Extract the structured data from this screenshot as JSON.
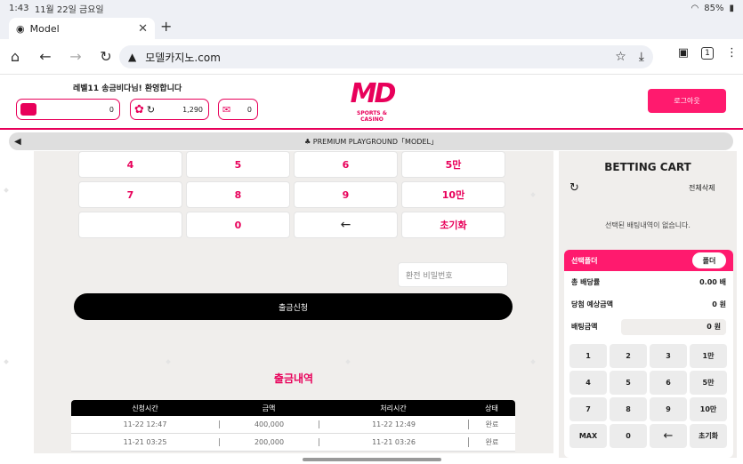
{
  "status_bar": {
    "time": "1:43",
    "date": "11월 22일 금요일",
    "battery": "85%"
  },
  "tab": {
    "title": "Model"
  },
  "address_bar": {
    "url": "모델카지노.com"
  },
  "header": {
    "welcome": "레벨11 송금비다님! 환영합니다",
    "wallet_balance": "0",
    "point_balance": "1,290",
    "message_count": "0",
    "logo_text": "MD",
    "logo_sub": "SPORTS & CASINO",
    "logout_label": "로그아웃"
  },
  "notice": {
    "text": "♣ PREMIUM PLAYGROUND「MODEL」"
  },
  "keypad": {
    "keys": [
      "4",
      "5",
      "6",
      "5만",
      "7",
      "8",
      "9",
      "10만",
      "",
      "0",
      "←",
      "초기화"
    ]
  },
  "withdraw": {
    "password_placeholder": "환전 비밀번호",
    "submit_label": "출금신청"
  },
  "history": {
    "title": "출금내역",
    "columns": [
      "신청시간",
      "금액",
      "처리시간",
      "상태"
    ],
    "rows": [
      [
        "11-22 12:47",
        "400,000",
        "11-22 12:49",
        "완료"
      ],
      [
        "11-21 03:25",
        "200,000",
        "11-21 03:26",
        "완료"
      ]
    ]
  },
  "cart": {
    "title": "BETTING CART",
    "clear_all": "전체삭제",
    "empty_message": "선택된 배팅내역이 없습니다.",
    "slip_label": "선택폴더",
    "fold_button": "폴더",
    "total_odds_label": "총 배당률",
    "total_odds": "0.00 배",
    "expected_win_label": "당첨 예상금액",
    "expected_win": "0 원",
    "bet_amount_label": "배팅금액",
    "bet_amount": "0 원",
    "keys": [
      "1",
      "2",
      "3",
      "1만",
      "4",
      "5",
      "6",
      "5만",
      "7",
      "8",
      "9",
      "10만",
      "MAX",
      "0",
      "←",
      "초기화"
    ]
  },
  "colors": {
    "accent": "#e8005a",
    "button": "#ff1a6e"
  }
}
